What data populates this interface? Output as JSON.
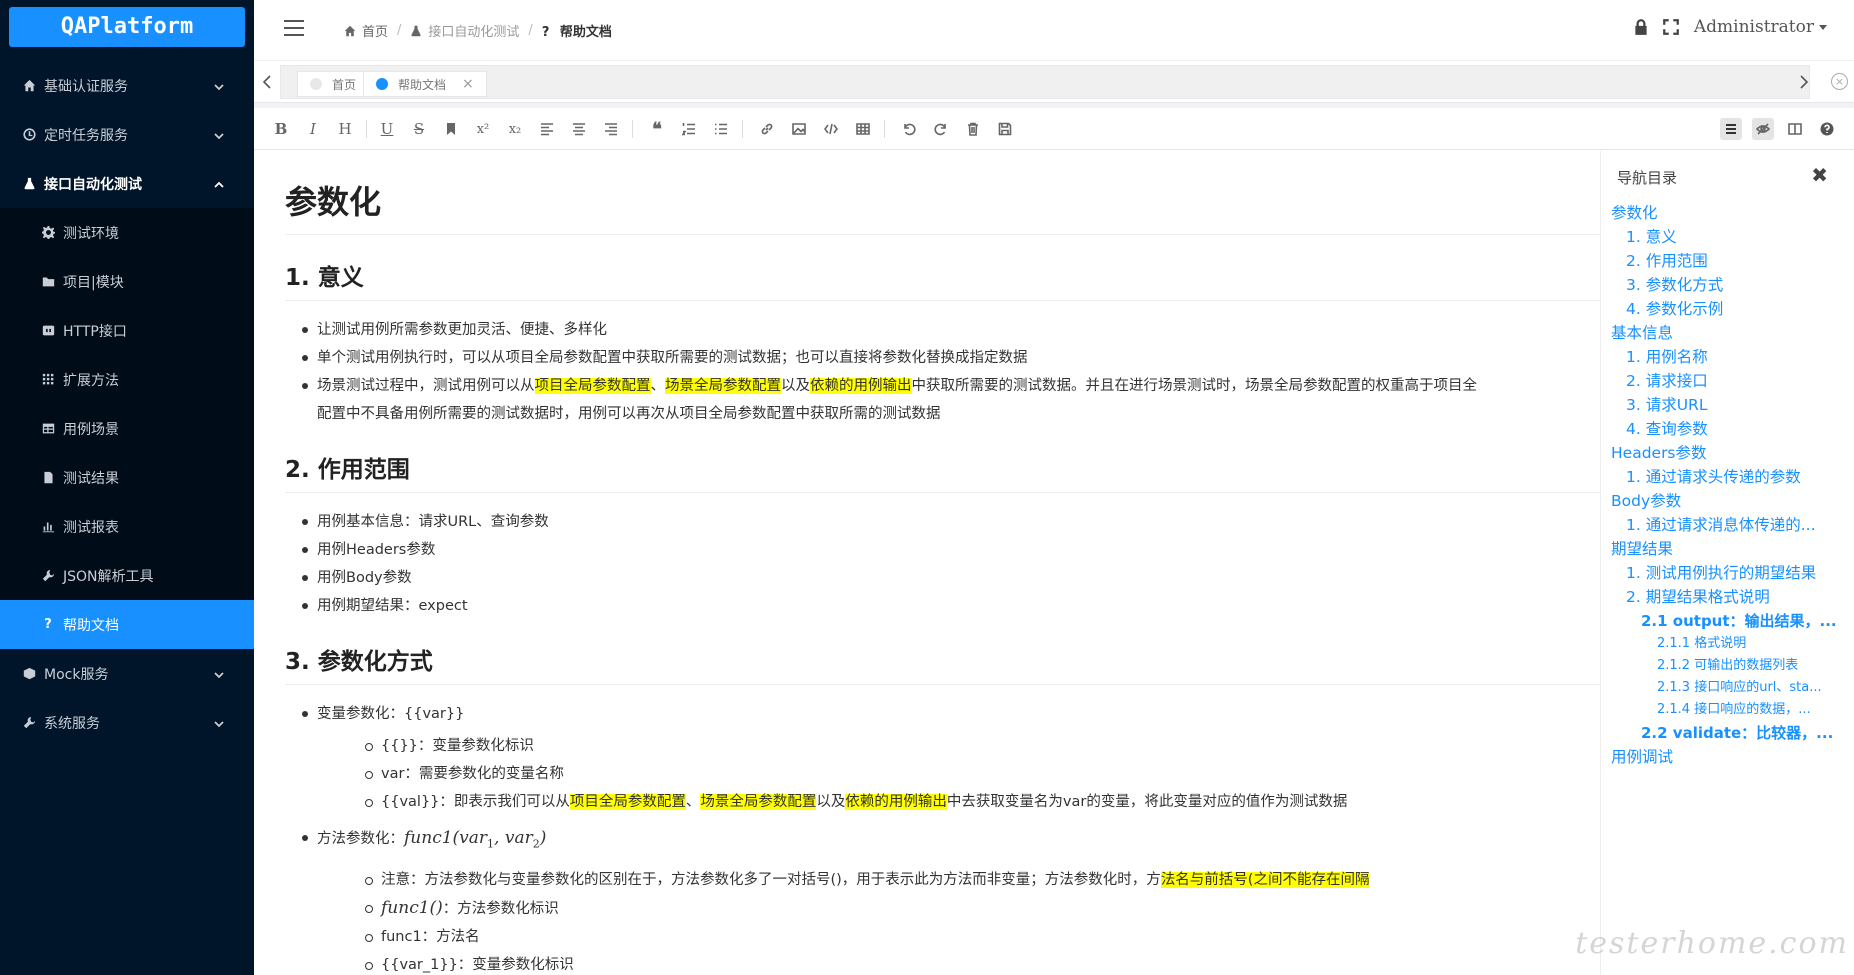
{
  "app": {
    "logo": "QAPlatform"
  },
  "sidebar": {
    "items": [
      {
        "label": "基础认证服务",
        "icon": "home-icon"
      },
      {
        "label": "定时任务服务",
        "icon": "clock-icon"
      },
      {
        "label": "接口自动化测试",
        "icon": "flask-icon"
      },
      {
        "label": "测试环境",
        "icon": "gear-icon"
      },
      {
        "label": "项目|模块",
        "icon": "folder-icon"
      },
      {
        "label": "HTTP接口",
        "icon": "plug-icon"
      },
      {
        "label": "扩展方法",
        "icon": "grid-icon"
      },
      {
        "label": "用例场景",
        "icon": "table-icon"
      },
      {
        "label": "测试结果",
        "icon": "file-icon"
      },
      {
        "label": "测试报表",
        "icon": "bar-chart-icon"
      },
      {
        "label": "JSON解析工具",
        "icon": "wrench-icon"
      },
      {
        "label": "帮助文档",
        "icon": "question-icon"
      },
      {
        "label": "Mock服务",
        "icon": "cube-icon"
      },
      {
        "label": "系统服务",
        "icon": "tools-icon"
      }
    ]
  },
  "header": {
    "breadcrumb": [
      "首页",
      "接口自动化测试",
      "帮助文档"
    ],
    "user": "Administrator"
  },
  "tags": [
    {
      "label": "首页",
      "active": false
    },
    {
      "label": "帮助文档",
      "active": true
    }
  ],
  "colors": {
    "accent": "#1890ff",
    "sidebar": "#001529",
    "highlight": "#ffff00"
  },
  "doc": {
    "h1": "参数化",
    "s1": {
      "title": "1. 意义",
      "b1": "让测试用例所需参数更加灵活、便捷、多样化",
      "b2": "单个测试用例执行时，可以从项目全局参数配置中获取所需要的测试数据；也可以直接将参数化替换成指定数据",
      "b3_a": "场景测试过程中，测试用例可以从",
      "b3_h1": "项目全局参数配置",
      "b3_b": "、",
      "b3_h2": "场景全局参数配置",
      "b3_c": "以及",
      "b3_h3": "依赖的用例输出",
      "b3_d": "中获取所需要的测试数据。并且在进行场景测试时，场景全局参数配置的权重高于项目全",
      "b3_e": "配置中不具备用例所需要的测试数据时，用例可以再次从项目全局参数配置中获取所需的测试数据"
    },
    "s2": {
      "title": "2. 作用范围",
      "b1": "用例基本信息：请求URL、查询参数",
      "b2": "用例Headers参数",
      "b3": "用例Body参数",
      "b4": "用例期望结果：expect"
    },
    "s3": {
      "title": "3. 参数化方式",
      "v": "变量参数化：{{var}}",
      "v1": "{{}}：变量参数化标识",
      "v2": "var：需要参数化的变量名称",
      "v3_a": "{{val}}：即表示我们可以从",
      "v3_h1": "项目全局参数配置",
      "v3_b": "、",
      "v3_h2": "场景全局参数配置",
      "v3_c": "以及",
      "v3_h3": "依赖的用例输出",
      "v3_d": "中去获取变量名为var的变量，将此变量对应的值作为测试数据",
      "f": "方法参数化：",
      "f_math": "func1(var",
      "f_sub1": "1",
      "f_mid": ", var",
      "f_sub2": "2",
      "f_end": ")",
      "f1_a": "注意：方法参数化与变量参数化的区别在于，方法参数化多了一对括号()，用于表示此为方法而非变量；方法参数化时，方",
      "f1_h": "法名与前括号(之间不能存在间隔",
      "f2_math": "func1()",
      "f2_text": "：方法参数化标识",
      "f3": "func1：方法名",
      "f4": "{{var_1}}：变量参数化标识"
    }
  },
  "toc": {
    "title": "导航目录",
    "items": [
      {
        "label": "参数化",
        "level": 1
      },
      {
        "label": "1. 意义",
        "level": 2
      },
      {
        "label": "2. 作用范围",
        "level": 2
      },
      {
        "label": "3. 参数化方式",
        "level": 2
      },
      {
        "label": "4. 参数化示例",
        "level": 2
      },
      {
        "label": "基本信息",
        "level": 1
      },
      {
        "label": "1. 用例名称",
        "level": 2
      },
      {
        "label": "2. 请求接口",
        "level": 2
      },
      {
        "label": "3. 请求URL",
        "level": 2
      },
      {
        "label": "4. 查询参数",
        "level": 2
      },
      {
        "label": "Headers参数",
        "level": 1
      },
      {
        "label": "1. 通过请求头传递的参数",
        "level": 2
      },
      {
        "label": "Body参数",
        "level": 1
      },
      {
        "label": "1. 通过请求消息体传递的...",
        "level": 2
      },
      {
        "label": "期望结果",
        "level": 1
      },
      {
        "label": "1. 测试用例执行的期望结果",
        "level": 2
      },
      {
        "label": "2. 期望结果格式说明",
        "level": 2
      },
      {
        "label": "2.1 output：输出结果，...",
        "level": 3
      },
      {
        "label": "2.1.1 格式说明",
        "level": 4
      },
      {
        "label": "2.1.2 可输出的数据列表",
        "level": 4
      },
      {
        "label": "2.1.3 接口响应的url、sta...",
        "level": 4
      },
      {
        "label": "2.1.4 接口响应的数据，...",
        "level": 4
      },
      {
        "label": "2.2 validate：比较器，...",
        "level": 3
      },
      {
        "label": "用例调试",
        "level": 1
      }
    ]
  },
  "watermark": "testerhome.com"
}
